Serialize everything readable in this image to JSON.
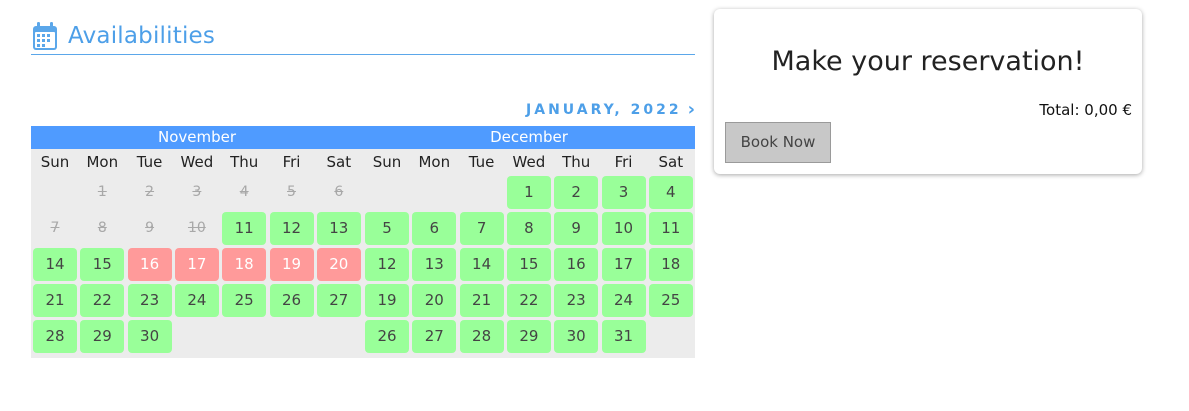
{
  "section": {
    "title": "Availabilities"
  },
  "nav": {
    "next_month_label": "JANUARY, 2022",
    "next_icon": "chevron-right-icon"
  },
  "calendar": {
    "months": [
      {
        "name": "November",
        "weekdays": [
          "Sun",
          "Mon",
          "Tue",
          "Wed",
          "Thu",
          "Fri",
          "Sat"
        ],
        "first_weekday": 1,
        "weeks": [
          [
            null,
            {
              "d": "1",
              "s": "past"
            },
            {
              "d": "2",
              "s": "past"
            },
            {
              "d": "3",
              "s": "past"
            },
            {
              "d": "4",
              "s": "past"
            },
            {
              "d": "5",
              "s": "past"
            },
            {
              "d": "6",
              "s": "past"
            }
          ],
          [
            {
              "d": "7",
              "s": "past"
            },
            {
              "d": "8",
              "s": "past"
            },
            {
              "d": "9",
              "s": "past"
            },
            {
              "d": "10",
              "s": "past"
            },
            {
              "d": "11",
              "s": "free"
            },
            {
              "d": "12",
              "s": "free"
            },
            {
              "d": "13",
              "s": "free"
            }
          ],
          [
            {
              "d": "14",
              "s": "free"
            },
            {
              "d": "15",
              "s": "free"
            },
            {
              "d": "16",
              "s": "booked"
            },
            {
              "d": "17",
              "s": "booked"
            },
            {
              "d": "18",
              "s": "booked"
            },
            {
              "d": "19",
              "s": "booked"
            },
            {
              "d": "20",
              "s": "booked"
            }
          ],
          [
            {
              "d": "21",
              "s": "free"
            },
            {
              "d": "22",
              "s": "free"
            },
            {
              "d": "23",
              "s": "free"
            },
            {
              "d": "24",
              "s": "free"
            },
            {
              "d": "25",
              "s": "free"
            },
            {
              "d": "26",
              "s": "free"
            },
            {
              "d": "27",
              "s": "free"
            }
          ],
          [
            {
              "d": "28",
              "s": "free"
            },
            {
              "d": "29",
              "s": "free"
            },
            {
              "d": "30",
              "s": "free"
            },
            null,
            null,
            null,
            null
          ]
        ]
      },
      {
        "name": "December",
        "weekdays": [
          "Sun",
          "Mon",
          "Tue",
          "Wed",
          "Thu",
          "Fri",
          "Sat"
        ],
        "first_weekday": 3,
        "weeks": [
          [
            null,
            null,
            null,
            {
              "d": "1",
              "s": "free"
            },
            {
              "d": "2",
              "s": "free"
            },
            {
              "d": "3",
              "s": "free"
            },
            {
              "d": "4",
              "s": "free"
            }
          ],
          [
            {
              "d": "5",
              "s": "free"
            },
            {
              "d": "6",
              "s": "free"
            },
            {
              "d": "7",
              "s": "free"
            },
            {
              "d": "8",
              "s": "free"
            },
            {
              "d": "9",
              "s": "free"
            },
            {
              "d": "10",
              "s": "free"
            },
            {
              "d": "11",
              "s": "free"
            }
          ],
          [
            {
              "d": "12",
              "s": "free"
            },
            {
              "d": "13",
              "s": "free"
            },
            {
              "d": "14",
              "s": "free"
            },
            {
              "d": "15",
              "s": "free"
            },
            {
              "d": "16",
              "s": "free"
            },
            {
              "d": "17",
              "s": "free"
            },
            {
              "d": "18",
              "s": "free"
            }
          ],
          [
            {
              "d": "19",
              "s": "free"
            },
            {
              "d": "20",
              "s": "free"
            },
            {
              "d": "21",
              "s": "free"
            },
            {
              "d": "22",
              "s": "free"
            },
            {
              "d": "23",
              "s": "free"
            },
            {
              "d": "24",
              "s": "free"
            },
            {
              "d": "25",
              "s": "free"
            }
          ],
          [
            {
              "d": "26",
              "s": "free"
            },
            {
              "d": "27",
              "s": "free"
            },
            {
              "d": "28",
              "s": "free"
            },
            {
              "d": "29",
              "s": "free"
            },
            {
              "d": "30",
              "s": "free"
            },
            {
              "d": "31",
              "s": "free"
            },
            null
          ]
        ]
      }
    ],
    "colors": {
      "header_bar": "#4f9bff",
      "free": "#99ff99",
      "booked": "#ff9a9a",
      "background": "#ececec"
    }
  },
  "reservation": {
    "title": "Make your reservation!",
    "total_label": "Total: 0,00 €",
    "book_button": "Book Now"
  },
  "icons": {
    "section": "calendar-icon"
  }
}
